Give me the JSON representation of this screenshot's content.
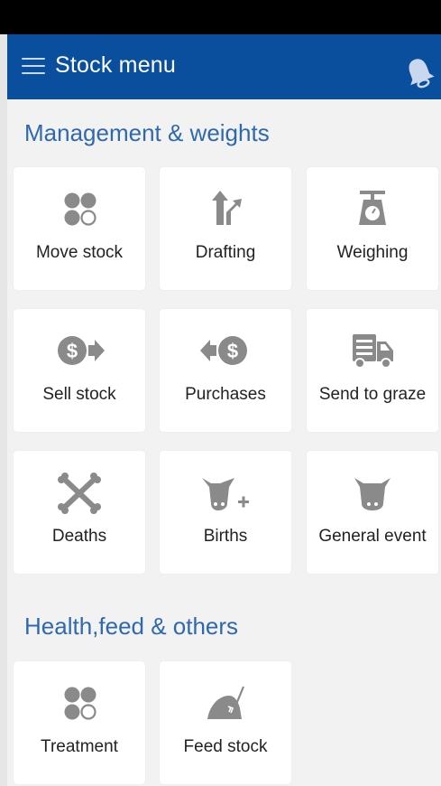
{
  "app_bar": {
    "title": "Stock menu",
    "menu_icon": "hamburger-menu-icon",
    "notification_icon": "bell-icon"
  },
  "colors": {
    "primary": "#0a4f9e",
    "section_title": "#2f69ad",
    "icon_gray": "#8a8a8a",
    "background": "#f2f2f2"
  },
  "sections": [
    {
      "title": "Management & weights",
      "tiles": [
        {
          "label": "Move stock",
          "icon": "move-stock-icon"
        },
        {
          "label": "Drafting",
          "icon": "drafting-arrows-icon"
        },
        {
          "label": "Weighing",
          "icon": "scale-icon"
        },
        {
          "label": "Sell stock",
          "icon": "sell-dollar-arrow-icon"
        },
        {
          "label": "Purchases",
          "icon": "purchase-dollar-arrow-icon"
        },
        {
          "label": "Send to graze",
          "icon": "truck-icon"
        },
        {
          "label": "Deaths",
          "icon": "crossbones-icon"
        },
        {
          "label": "Births",
          "icon": "cow-plus-icon"
        },
        {
          "label": "General event",
          "icon": "cow-head-icon"
        }
      ]
    },
    {
      "title": "Health,feed & others",
      "tiles": [
        {
          "label": "Treatment",
          "icon": "treatment-icon"
        },
        {
          "label": "Feed stock",
          "icon": "hay-fork-icon"
        }
      ]
    }
  ]
}
